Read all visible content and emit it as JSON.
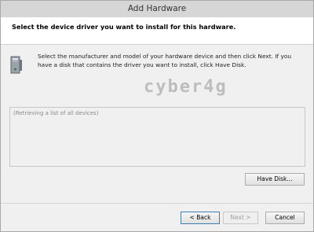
{
  "window": {
    "title": "Add Hardware"
  },
  "header": {
    "heading": "Select the device driver you want to install for this hardware."
  },
  "instructions": "Select the manufacturer and model of your hardware device and then click Next. If you have a disk that contains the driver you want to install, click Have Disk.",
  "watermark": "cyber4g",
  "device_list": {
    "status": "(Retrieving a list of all devices)"
  },
  "buttons": {
    "have_disk": "Have Disk...",
    "back": "< Back",
    "next": "Next >",
    "cancel": "Cancel"
  },
  "icons": {
    "hardware": "hardware-device-icon"
  }
}
